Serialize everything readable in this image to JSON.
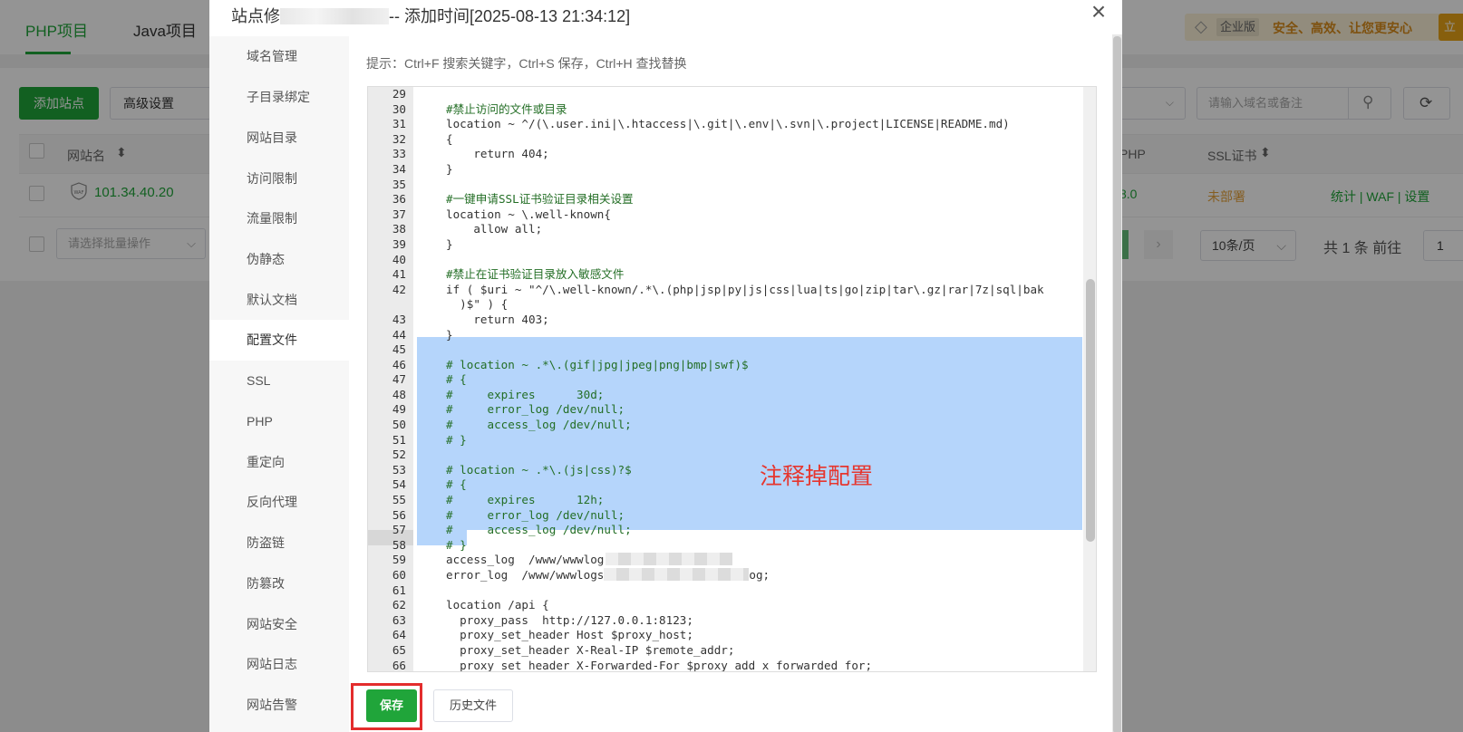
{
  "background": {
    "tabs": [
      "PHP项目",
      "Java项目"
    ],
    "vip_badge": "企业版",
    "vip_text": "安全、高效、让您更安心",
    "add_site_button": "添加站点",
    "advanced_button": "高级设置",
    "search_placeholder": "请输入域名或备注",
    "table_headers": {
      "site": "网站名",
      "php": "PHP",
      "ssl": "SSL证书"
    },
    "row": {
      "site": "101.34.40.20",
      "php": "8.0",
      "ssl": "未部署",
      "actions": "统计 | WAF | 设置"
    },
    "batch_placeholder": "请选择批量操作",
    "page_size": "10条/页",
    "total": "共 1 条  前往",
    "page_number": "1"
  },
  "modal": {
    "title_prefix": "站点修",
    "title_suffix": "-- 添加时间[2025-08-13 21:34:12]",
    "close_icon": "×",
    "nav_items": [
      "域名管理",
      "子目录绑定",
      "网站目录",
      "访问限制",
      "流量限制",
      "伪静态",
      "默认文档",
      "配置文件",
      "SSL",
      "PHP",
      "重定向",
      "反向代理",
      "防盗链",
      "防篡改",
      "网站安全",
      "网站日志",
      "网站告警"
    ],
    "active_nav": "配置文件",
    "hint": "提示：Ctrl+F 搜索关键字，Ctrl+S 保存，Ctrl+H 查找替换",
    "annotation": "注释掉配置",
    "save_button": "保存",
    "history_button": "历史文件"
  },
  "editor": {
    "lines": [
      {
        "n": "29",
        "t": ""
      },
      {
        "n": "30",
        "t": "#禁止访问的文件或目录"
      },
      {
        "n": "31",
        "t": "location ~ ^/(\\.user.ini|\\.htaccess|\\.git|\\.env|\\.svn|\\.project|LICENSE|README.md)"
      },
      {
        "n": "32",
        "t": "{"
      },
      {
        "n": "33",
        "t": "    return 404;"
      },
      {
        "n": "34",
        "t": "}"
      },
      {
        "n": "35",
        "t": ""
      },
      {
        "n": "36",
        "t": "#一键申请SSL证书验证目录相关设置"
      },
      {
        "n": "37",
        "t": "location ~ \\.well-known{"
      },
      {
        "n": "38",
        "t": "    allow all;"
      },
      {
        "n": "39",
        "t": "}"
      },
      {
        "n": "40",
        "t": ""
      },
      {
        "n": "41",
        "t": "#禁止在证书验证目录放入敏感文件"
      },
      {
        "n": "42",
        "t": "if ( $uri ~ \"^/\\.well-known/.*\\.(php|jsp|py|js|css|lua|ts|go|zip|tar\\.gz|rar|7z|sql|bak"
      },
      {
        "n": "",
        "t": "  )$\" ) {"
      },
      {
        "n": "43",
        "t": "    return 403;"
      },
      {
        "n": "44",
        "t": "}"
      },
      {
        "n": "45",
        "t": ""
      },
      {
        "n": "46",
        "t": "# location ~ .*\\.(gif|jpg|jpeg|png|bmp|swf)$"
      },
      {
        "n": "47",
        "t": "# {"
      },
      {
        "n": "48",
        "t": "#     expires      30d;"
      },
      {
        "n": "49",
        "t": "#     error_log /dev/null;"
      },
      {
        "n": "50",
        "t": "#     access_log /dev/null;"
      },
      {
        "n": "51",
        "t": "# }"
      },
      {
        "n": "52",
        "t": ""
      },
      {
        "n": "53",
        "t": "# location ~ .*\\.(js|css)?$"
      },
      {
        "n": "54",
        "t": "# {"
      },
      {
        "n": "55",
        "t": "#     expires      12h;"
      },
      {
        "n": "56",
        "t": "#     error_log /dev/null;"
      },
      {
        "n": "57",
        "t": "#     access_log /dev/null;"
      },
      {
        "n": "58",
        "t": "# }"
      },
      {
        "n": "59",
        "t": "access_log  /www/wwwlog"
      },
      {
        "n": "60",
        "t": "error_log  /www/wwwlogs"
      },
      {
        "n": "61",
        "t": ""
      },
      {
        "n": "62",
        "t": "location /api {"
      },
      {
        "n": "63",
        "t": "  proxy_pass  http://127.0.0.1:8123;"
      },
      {
        "n": "64",
        "t": "  proxy_set_header Host $proxy_host;"
      },
      {
        "n": "65",
        "t": "  proxy_set_header X-Real-IP $remote_addr;"
      },
      {
        "n": "66",
        "t": "  proxy_set_header X-Forwarded-For $proxy_add_x_forwarded_for;"
      }
    ],
    "line60_tail": "og;"
  },
  "colors": {
    "brand_green": "#20a53a",
    "selection": "#b5d5fb",
    "annotation_red": "#e6362e"
  }
}
